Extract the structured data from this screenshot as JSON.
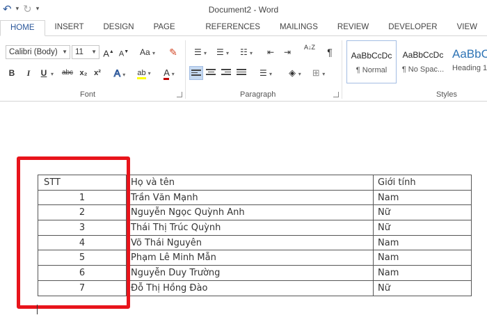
{
  "window": {
    "title": "Document2 - Word"
  },
  "qat": {
    "undo": "↶",
    "undo_arrow": "▾",
    "redo": "↻",
    "customize": "▾"
  },
  "tabs": [
    "HOME",
    "INSERT",
    "DESIGN",
    "PAGE LAYOUT",
    "REFERENCES",
    "MAILINGS",
    "REVIEW",
    "DEVELOPER",
    "VIEW"
  ],
  "ribbon": {
    "font": {
      "label": "Font",
      "font_name": "Calibri (Body)",
      "font_size": "11",
      "grow": "A",
      "shrink": "A",
      "change_case": "Aa",
      "bold": "B",
      "italic": "I",
      "underline": "U",
      "strike": "abc",
      "subscript": "x₂",
      "superscript": "x²",
      "text_effects": "A",
      "highlight": "ab",
      "font_color": "A"
    },
    "paragraph": {
      "label": "Paragraph",
      "sort": "A↓Z",
      "pilcrow": "¶"
    },
    "styles": {
      "label": "Styles",
      "items": [
        {
          "sample": "AaBbCcDc",
          "name": "¶ Normal"
        },
        {
          "sample": "AaBbCcDc",
          "name": "¶ No Spac..."
        },
        {
          "sample": "AaBbC",
          "name": "Heading 1"
        }
      ]
    }
  },
  "table": {
    "headers": [
      "STT",
      "Họ và tên",
      "Giới tính"
    ],
    "rows": [
      [
        "1",
        "Trần Văn Mạnh",
        "Nam"
      ],
      [
        "2",
        "Nguyễn Ngọc Quỳnh Anh",
        "Nữ"
      ],
      [
        "3",
        "Thái Thị Trúc Quỳnh",
        "Nữ"
      ],
      [
        "4",
        "Võ  Thái Nguyên",
        "Nam"
      ],
      [
        "5",
        "Phạm Lê Minh Mẫn",
        "Nam"
      ],
      [
        "6",
        "Nguyễn Duy Trường",
        "Nam"
      ],
      [
        "7",
        "Đỗ Thị Hồng Đào",
        "Nữ"
      ]
    ]
  },
  "colors": {
    "accent": "#2b579a",
    "annotation": "#e8141b"
  }
}
